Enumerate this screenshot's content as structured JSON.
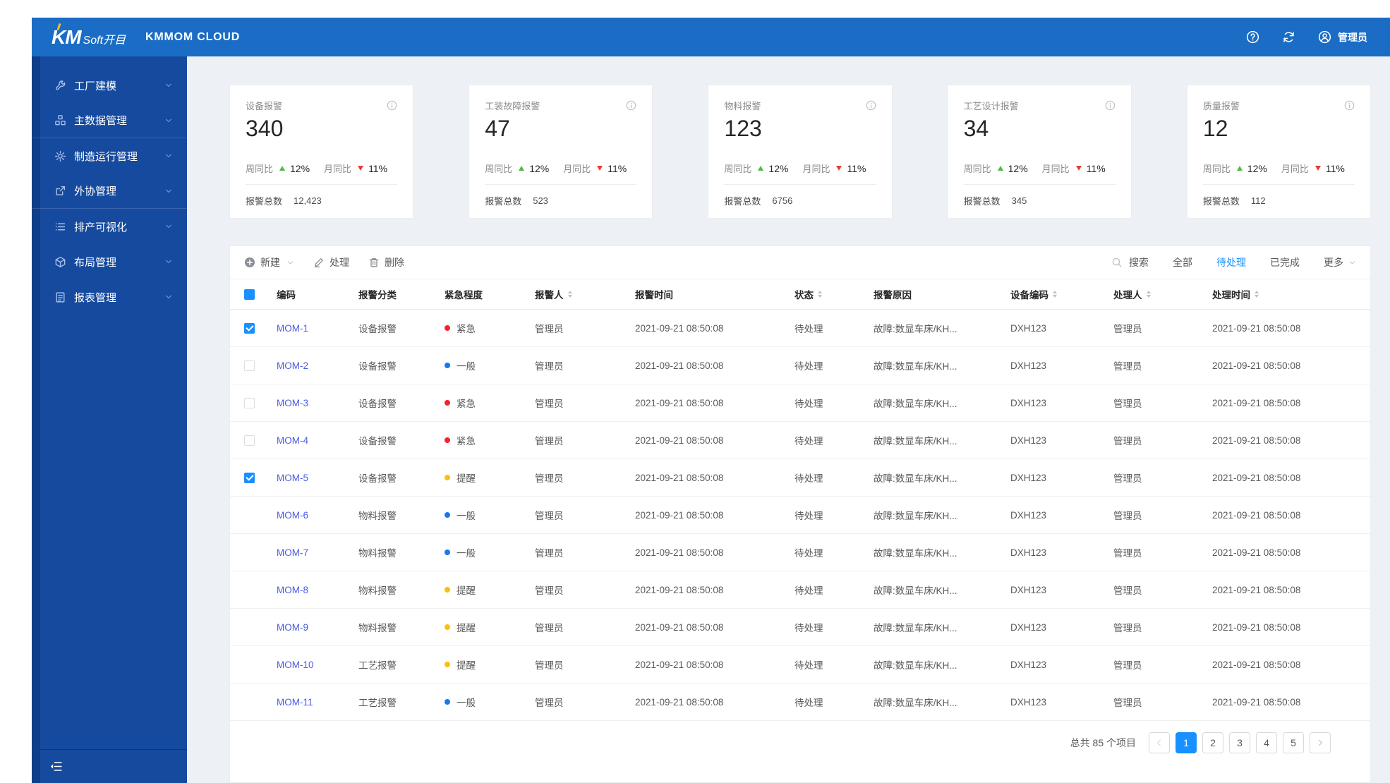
{
  "colors": {
    "accent": "#1890ff",
    "header_bg": "#1a6cc4",
    "sidebar_bg": "#154a9e",
    "link": "#4b5ce4",
    "urgent": "#f5222d",
    "normal": "#1777ee",
    "remind": "#fbbf0d",
    "up": "#52b944",
    "down": "#eb3a3a"
  },
  "header": {
    "logo_mark": "KM",
    "logo_suffix": "Soft开目",
    "product": "KMMOM CLOUD",
    "user": "管理员"
  },
  "sidebar": {
    "items": [
      {
        "key": "factory-modeling",
        "icon": "wrench-icon",
        "label": "工厂建模"
      },
      {
        "key": "master-data",
        "icon": "blocks-icon",
        "label": "主数据管理"
      },
      {
        "key": "manufacturing-ops",
        "icon": "gear-icon",
        "label": "制造运行管理"
      },
      {
        "key": "outsourcing",
        "icon": "outsource-icon",
        "label": "外协管理"
      },
      {
        "key": "scheduling-visual",
        "icon": "list-icon",
        "label": "排产可视化"
      },
      {
        "key": "layout",
        "icon": "cube-icon",
        "label": "布局管理"
      },
      {
        "key": "reports",
        "icon": "report-icon",
        "label": "报表管理"
      }
    ]
  },
  "stats": {
    "cards": [
      {
        "title": "设备报警",
        "value": "340",
        "week_label": "周同比",
        "week_value": "12%",
        "month_label": "月同比",
        "month_value": "11%",
        "total_label": "报警总数",
        "total_value": "12,423"
      },
      {
        "title": "工装故障报警",
        "value": "47",
        "week_label": "周同比",
        "week_value": "12%",
        "month_label": "月同比",
        "month_value": "11%",
        "total_label": "报警总数",
        "total_value": "523"
      },
      {
        "title": "物料报警",
        "value": "123",
        "week_label": "周同比",
        "week_value": "12%",
        "month_label": "月同比",
        "month_value": "11%",
        "total_label": "报警总数",
        "total_value": "6756"
      },
      {
        "title": "工艺设计报警",
        "value": "34",
        "week_label": "周同比",
        "week_value": "12%",
        "month_label": "月同比",
        "month_value": "11%",
        "total_label": "报警总数",
        "total_value": "345"
      },
      {
        "title": "质量报警",
        "value": "12",
        "week_label": "周同比",
        "week_value": "12%",
        "month_label": "月同比",
        "month_value": "11%",
        "total_label": "报警总数",
        "total_value": "112"
      }
    ]
  },
  "toolbar": {
    "new_label": "新建",
    "process_label": "处理",
    "delete_label": "删除",
    "search_label": "搜索",
    "filters": [
      {
        "label": "全部"
      },
      {
        "label": "待处理"
      },
      {
        "label": "已完成"
      }
    ],
    "active_filter": "待处理",
    "more_label": "更多"
  },
  "table": {
    "select_all": true,
    "columns": [
      {
        "label": "编码",
        "sortable": false
      },
      {
        "label": "报警分类",
        "sortable": false
      },
      {
        "label": "紧急程度",
        "sortable": false
      },
      {
        "label": "报警人",
        "sortable": true
      },
      {
        "label": "报警时间",
        "sortable": false
      },
      {
        "label": "状态",
        "sortable": true
      },
      {
        "label": "报警原因",
        "sortable": false
      },
      {
        "label": "设备编码",
        "sortable": true
      },
      {
        "label": "处理人",
        "sortable": true
      },
      {
        "label": "处理时间",
        "sortable": true
      }
    ],
    "rows": [
      {
        "checkbox": "checked",
        "code": "MOM-1",
        "category": "设备报警",
        "urgency_label": "紧急",
        "urgency_level": "urgent",
        "reporter": "管理员",
        "alarm_time": "2021-09-21  08:50:08",
        "status": "待处理",
        "reason": "故障:数显车床/KH...",
        "device_code": "DXH123",
        "handler": "管理员",
        "handle_time": "2021-09-21  08:50:08"
      },
      {
        "checkbox": "unchecked",
        "code": "MOM-2",
        "category": "设备报警",
        "urgency_label": "一般",
        "urgency_level": "normal",
        "reporter": "管理员",
        "alarm_time": "2021-09-21  08:50:08",
        "status": "待处理",
        "reason": "故障:数显车床/KH...",
        "device_code": "DXH123",
        "handler": "管理员",
        "handle_time": "2021-09-21  08:50:08"
      },
      {
        "checkbox": "unchecked",
        "code": "MOM-3",
        "category": "设备报警",
        "urgency_label": "紧急",
        "urgency_level": "urgent",
        "reporter": "管理员",
        "alarm_time": "2021-09-21  08:50:08",
        "status": "待处理",
        "reason": "故障:数显车床/KH...",
        "device_code": "DXH123",
        "handler": "管理员",
        "handle_time": "2021-09-21  08:50:08"
      },
      {
        "checkbox": "unchecked",
        "code": "MOM-4",
        "category": "设备报警",
        "urgency_label": "紧急",
        "urgency_level": "urgent",
        "reporter": "管理员",
        "alarm_time": "2021-09-21  08:50:08",
        "status": "待处理",
        "reason": "故障:数显车床/KH...",
        "device_code": "DXH123",
        "handler": "管理员",
        "handle_time": "2021-09-21  08:50:08"
      },
      {
        "checkbox": "checked",
        "code": "MOM-5",
        "category": "设备报警",
        "urgency_label": "提醒",
        "urgency_level": "remind",
        "reporter": "管理员",
        "alarm_time": "2021-09-21  08:50:08",
        "status": "待处理",
        "reason": "故障:数显车床/KH...",
        "device_code": "DXH123",
        "handler": "管理员",
        "handle_time": "2021-09-21  08:50:08"
      },
      {
        "checkbox": "none",
        "code": "MOM-6",
        "category": "物料报警",
        "urgency_label": "一般",
        "urgency_level": "normal",
        "reporter": "管理员",
        "alarm_time": "2021-09-21  08:50:08",
        "status": "待处理",
        "reason": "故障:数显车床/KH...",
        "device_code": "DXH123",
        "handler": "管理员",
        "handle_time": "2021-09-21  08:50:08"
      },
      {
        "checkbox": "none",
        "code": "MOM-7",
        "category": "物料报警",
        "urgency_label": "一般",
        "urgency_level": "normal",
        "reporter": "管理员",
        "alarm_time": "2021-09-21  08:50:08",
        "status": "待处理",
        "reason": "故障:数显车床/KH...",
        "device_code": "DXH123",
        "handler": "管理员",
        "handle_time": "2021-09-21  08:50:08"
      },
      {
        "checkbox": "none",
        "code": "MOM-8",
        "category": "物料报警",
        "urgency_label": "提醒",
        "urgency_level": "remind",
        "reporter": "管理员",
        "alarm_time": "2021-09-21  08:50:08",
        "status": "待处理",
        "reason": "故障:数显车床/KH...",
        "device_code": "DXH123",
        "handler": "管理员",
        "handle_time": "2021-09-21  08:50:08"
      },
      {
        "checkbox": "none",
        "code": "MOM-9",
        "category": "物料报警",
        "urgency_label": "提醒",
        "urgency_level": "remind",
        "reporter": "管理员",
        "alarm_time": "2021-09-21  08:50:08",
        "status": "待处理",
        "reason": "故障:数显车床/KH...",
        "device_code": "DXH123",
        "handler": "管理员",
        "handle_time": "2021-09-21  08:50:08"
      },
      {
        "checkbox": "none",
        "code": "MOM-10",
        "category": "工艺报警",
        "urgency_label": "提醒",
        "urgency_level": "remind",
        "reporter": "管理员",
        "alarm_time": "2021-09-21  08:50:08",
        "status": "待处理",
        "reason": "故障:数显车床/KH...",
        "device_code": "DXH123",
        "handler": "管理员",
        "handle_time": "2021-09-21  08:50:08"
      },
      {
        "checkbox": "none",
        "code": "MOM-11",
        "category": "工艺报警",
        "urgency_label": "一般",
        "urgency_level": "normal",
        "reporter": "管理员",
        "alarm_time": "2021-09-21  08:50:08",
        "status": "待处理",
        "reason": "故障:数显车床/KH...",
        "device_code": "DXH123",
        "handler": "管理员",
        "handle_time": "2021-09-21  08:50:08"
      }
    ]
  },
  "pagination": {
    "total_text": "总共 85 个项目",
    "pages": [
      {
        "label": "1"
      },
      {
        "label": "2"
      },
      {
        "label": "3"
      },
      {
        "label": "4"
      },
      {
        "label": "5"
      }
    ],
    "current": "1"
  }
}
